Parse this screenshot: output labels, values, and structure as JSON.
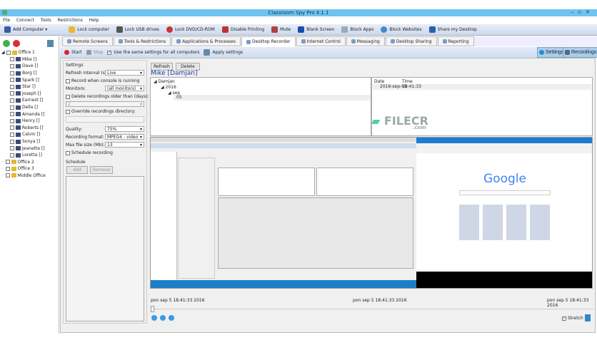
{
  "window": {
    "title": "Classroom Spy Pro 4.1.1",
    "controls": "–▫✕"
  },
  "menu": [
    "File",
    "Connect",
    "Tools",
    "Restrictions",
    "Help"
  ],
  "toolbar": [
    "Add Computer ▾",
    "Lock computer",
    "Lock USB drives",
    "Lock DVD/CD-ROM",
    "Disable Printing",
    "Mute",
    "Blank Screen",
    "Block Apps",
    "Block Websites",
    "Share my Desktop"
  ],
  "tabs": [
    "Remote Screens",
    "Tools & Restrictions",
    "Applications & Processes",
    "Desktop Recorder",
    "Internet Control",
    "Messaging",
    "Desktop Sharing",
    "Reporting"
  ],
  "active_tab": "Desktop Recorder",
  "subbar": {
    "start": "Start",
    "stop": "Stop",
    "same_settings": "Use the same settings for all computers",
    "apply": "Apply settings",
    "settings": "Settings",
    "recordings": "Recordings"
  },
  "tree": {
    "office1": "Office 1",
    "computers": [
      "Mike []",
      "Dave []",
      "Borg []",
      "Spark []",
      "Star []",
      "Joseph []",
      "Earnest []",
      "Della []",
      "Amanda []",
      "Henry []",
      "Roberts []",
      "Calvin []",
      "Sonya []",
      "Jeanette []",
      "Loretta []"
    ],
    "others": [
      "Office 2",
      "Office 3",
      "Middle Office"
    ]
  },
  "settings": {
    "group": "Settings",
    "refresh_label": "Refresh interval (s):",
    "refresh_value": "Live",
    "record_console": "Record when console is running",
    "monitors_label": "Monitors:",
    "monitors_value": "(all monitors)",
    "delete_older": "Delete recordings older than (days):",
    "days_value": "2",
    "override_dir": "Override recordings directory:",
    "quality_label": "Quality:",
    "quality_value": "75%",
    "format_label": "Recording format:",
    "format_value": "MPEG4 - video",
    "maxsize_label": "Max file size (Mb):",
    "maxsize_value": "13",
    "schedule_rec": "Schedule recording",
    "schedule_group": "Schedule",
    "add": "Add",
    "remove": "Remove"
  },
  "recordings": {
    "refresh": "Refresh",
    "delete": "Delete",
    "computer": "Mike [Damjan]",
    "tree": [
      "Damjan",
      "2016",
      "sep",
      "05"
    ],
    "col_date": "Date",
    "col_time": "Time",
    "rows": [
      {
        "date": "2016-sep-05",
        "time": "18:41:33"
      }
    ]
  },
  "timeline": {
    "start": "pon sep 5 18:41:33 2016",
    "mid": "pon sep 5 18:41:33 2016",
    "end": "pon sep 5 18:41:33 2016",
    "stretch": "Stretch",
    "position": 0
  },
  "preview": {
    "google": "Google",
    "watermark": "FILECR",
    "watermark_sub": ".com"
  }
}
